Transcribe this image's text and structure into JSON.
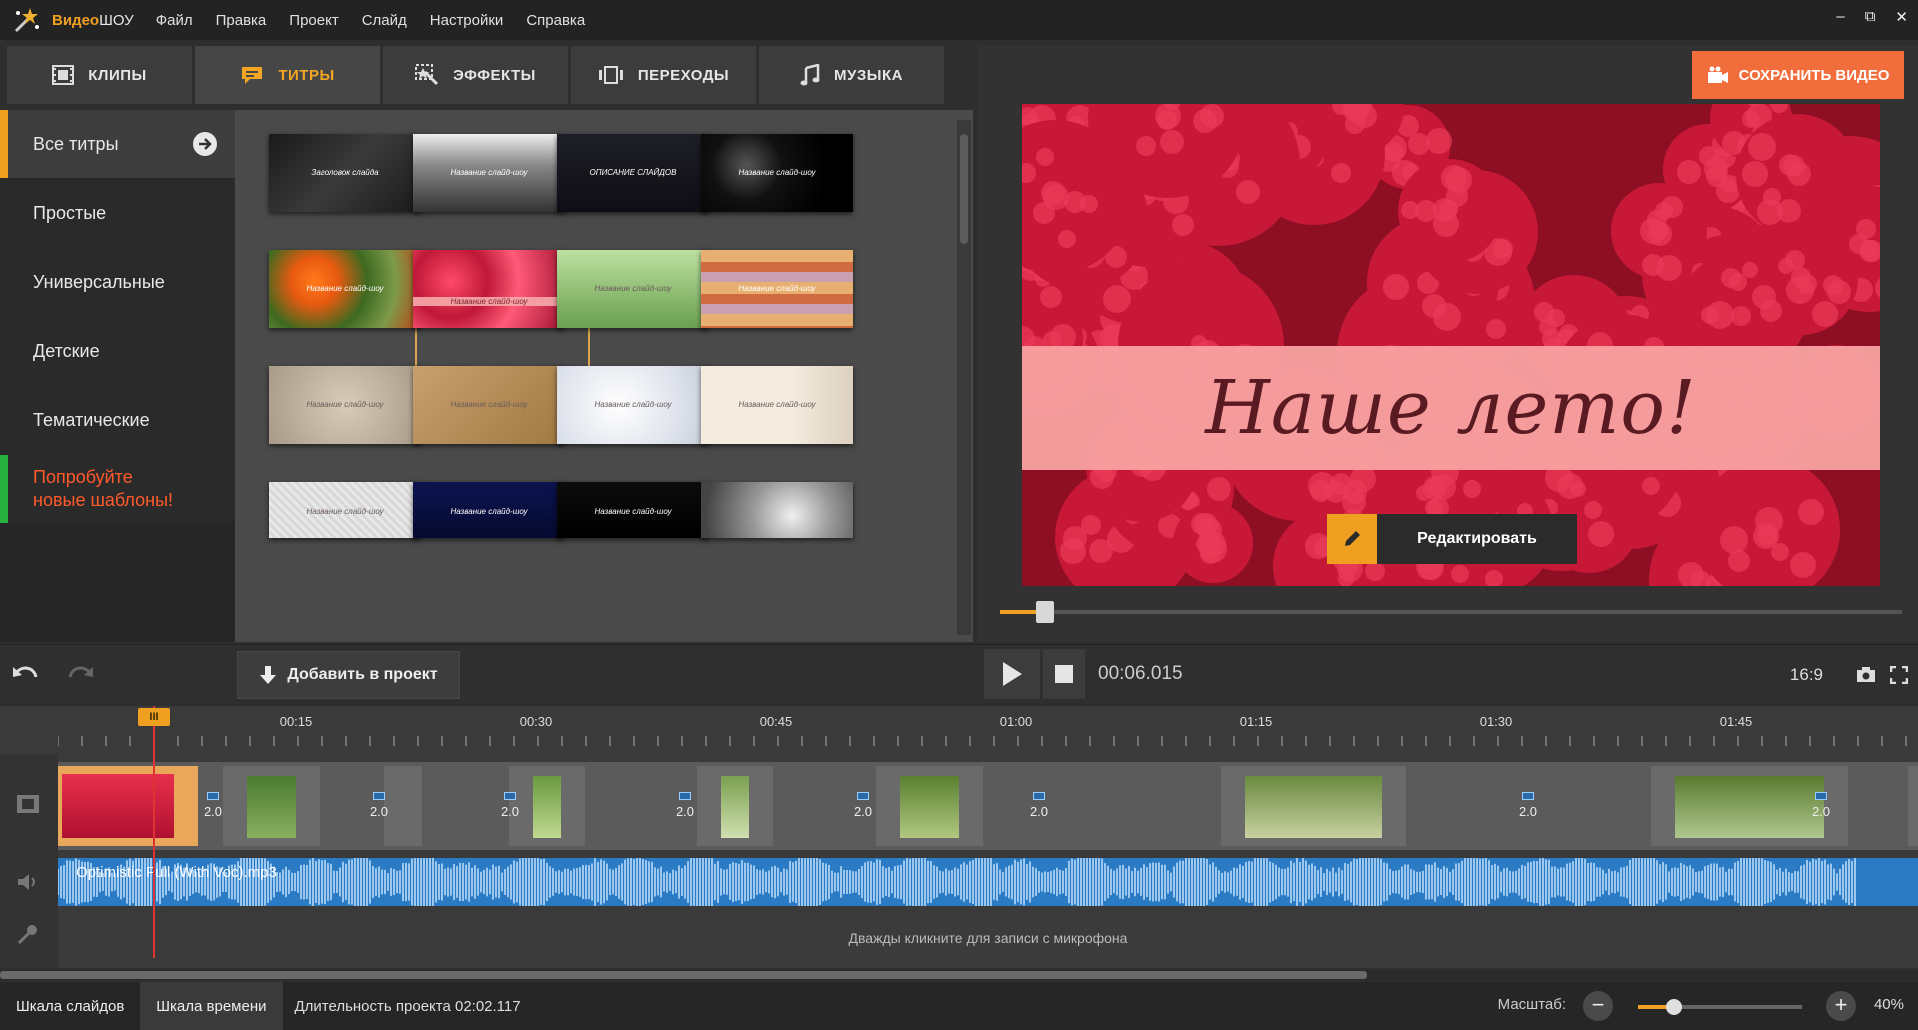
{
  "app": {
    "name_prefix": "Видео",
    "name_suffix": "ШОУ"
  },
  "menu": [
    "Файл",
    "Правка",
    "Проект",
    "Слайд",
    "Настройки",
    "Справка"
  ],
  "window_controls": [
    "–",
    "⧉",
    "✕"
  ],
  "tabs": [
    {
      "label": "КЛИПЫ",
      "icon": "film-icon",
      "active": false
    },
    {
      "label": "ТИТРЫ",
      "icon": "title-icon",
      "active": true
    },
    {
      "label": "ЭФФЕКТЫ",
      "icon": "effects-icon",
      "active": false
    },
    {
      "label": "ПЕРЕХОДЫ",
      "icon": "transitions-icon",
      "active": false
    },
    {
      "label": "МУЗЫКА",
      "icon": "music-icon",
      "active": false
    }
  ],
  "categories": [
    {
      "label": "Все титры",
      "active": true
    },
    {
      "label": "Простые"
    },
    {
      "label": "Универсальные"
    },
    {
      "label": "Детские"
    },
    {
      "label": "Тематические"
    }
  ],
  "promo": {
    "line1": "Попробуйте",
    "line2": "новые шаблоны!",
    "color": "#ff5a2a"
  },
  "templates": [
    {
      "caption": "Заголовок слайда",
      "style": "dark-lines"
    },
    {
      "caption": "Название слайд-шоу",
      "style": "city"
    },
    {
      "caption": "ОПИСАНИЕ СЛАЙДОВ",
      "style": "dark-text"
    },
    {
      "caption": "Название слайд-шоу",
      "style": "space"
    },
    {
      "caption": "Название слайд-шоу",
      "style": "flowers-orange"
    },
    {
      "caption": "Название слайд-шоу",
      "style": "raspberry"
    },
    {
      "caption": "Название слайд-шоу",
      "style": "green-flowers"
    },
    {
      "caption": "Название слайд-шоу",
      "style": "macarons"
    },
    {
      "caption": "Название слайд-шоу",
      "style": "vintage"
    },
    {
      "caption": "Название слайд-шоу",
      "style": "paper"
    },
    {
      "caption": "Название слайд-шоу",
      "style": "white-flower"
    },
    {
      "caption": "Название слайд-шоу",
      "style": "tulip"
    },
    {
      "caption": "Название слайд-шоу",
      "style": "fabric"
    },
    {
      "caption": "Название слайд-шоу",
      "style": "navy"
    },
    {
      "caption": "Название слайд-шоу",
      "style": "black"
    },
    {
      "caption": "",
      "style": "silver"
    }
  ],
  "selected_template_index": 5,
  "save_button": "СОХРАНИТЬ ВИДЕО",
  "preview": {
    "title_text": "Наше лето!",
    "edit_button": "Редактировать",
    "progress": 0.05
  },
  "controls": {
    "add_to_project": "Добавить в проект",
    "timecode": "00:06.015",
    "aspect_ratio": "16:9"
  },
  "timeline": {
    "ruler_labels": [
      "00:15",
      "00:30",
      "00:45",
      "01:00",
      "01:15",
      "01:30",
      "01:45"
    ],
    "playhead_label": "III",
    "transitions": [
      "2.0",
      "2.0",
      "2.0",
      "2.0",
      "2.0",
      "2.0",
      "2.0",
      "2.0"
    ],
    "audio_track": "Optimistic Full (With Voc).mp3",
    "mic_hint": "Дважды кликните для записи с микрофона"
  },
  "statusbar": {
    "tab_slides": "Шкала слайдов",
    "tab_timeline": "Шкала времени",
    "duration": "Длительность проекта 02:02.117",
    "zoom_label": "Масштаб:",
    "zoom_value": "40%",
    "zoom_level": 0.4
  },
  "colors": {
    "accent": "#f0a020",
    "save": "#f16d3b",
    "audio": "#2a7ac4",
    "promo_bar": "#27b240"
  }
}
